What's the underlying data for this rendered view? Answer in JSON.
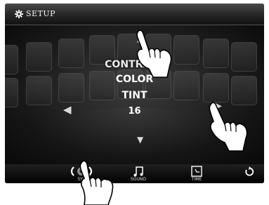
{
  "header": {
    "title": "SETUP",
    "icon": "gear-icon"
  },
  "menu": {
    "items": [
      "CONTRAST",
      "COLOR",
      "TINT"
    ],
    "value": "16"
  },
  "bottom_bar": {
    "sys_label": "SYS",
    "sound_label": "SOUND",
    "time_label": "TIME"
  },
  "icons": [
    "gear-icon",
    "arrow-up-icon",
    "arrow-down-icon",
    "arrow-left-icon",
    "arrow-right-icon",
    "system-icon",
    "music-note-icon",
    "clock-icon",
    "back-icon",
    "hand-pointer-icon"
  ]
}
